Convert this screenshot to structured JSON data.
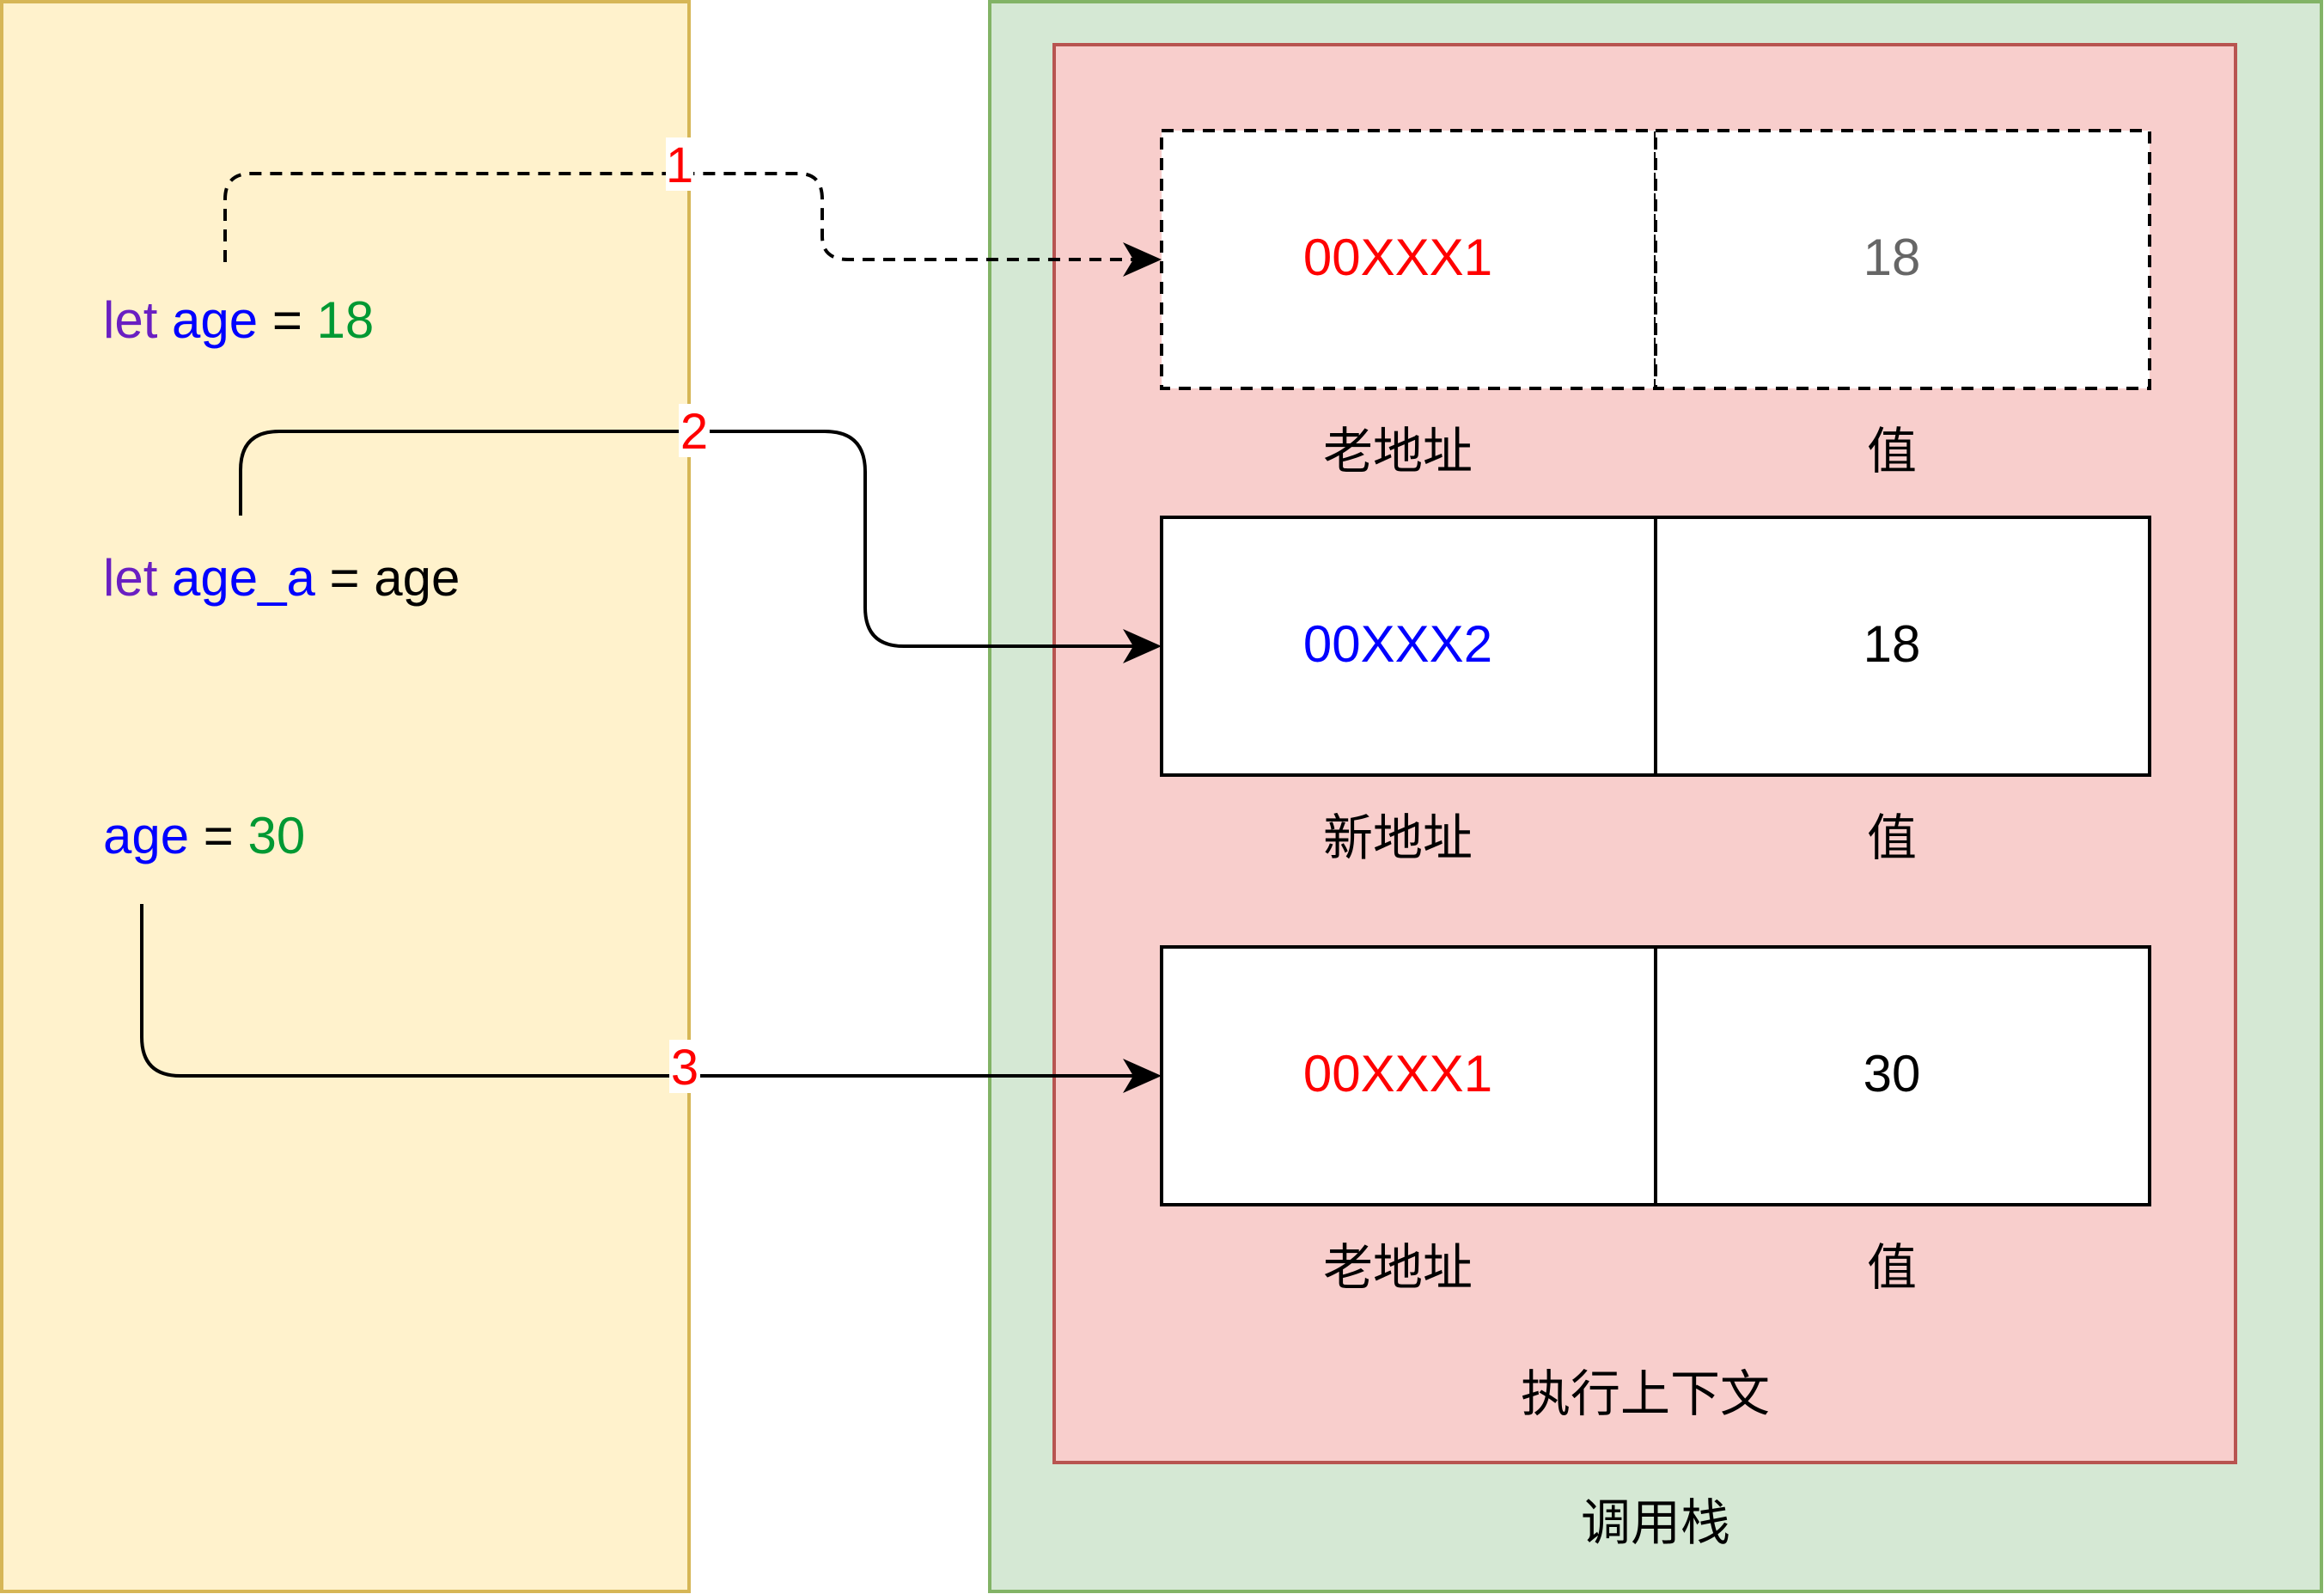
{
  "code_panel": {
    "lines": [
      {
        "tokens": [
          {
            "text": "let",
            "color": "#6a1fc2"
          },
          {
            "text": " age",
            "color": "#0000ff"
          },
          {
            "text": " = ",
            "color": "#000000"
          },
          {
            "text": "18",
            "color": "#009933"
          }
        ]
      },
      {
        "tokens": [
          {
            "text": "let",
            "color": "#6a1fc2"
          },
          {
            "text": " age_a",
            "color": "#0000ff"
          },
          {
            "text": " = ",
            "color": "#000000"
          },
          {
            "text": "age",
            "color": "#000000"
          }
        ]
      },
      {
        "tokens": [
          {
            "text": "age",
            "color": "#0000ff"
          },
          {
            "text": " = ",
            "color": "#000000"
          },
          {
            "text": "30",
            "color": "#009933"
          }
        ]
      }
    ]
  },
  "call_stack": {
    "label": "调用栈",
    "execution_context": {
      "label": "执行上下文",
      "entries": [
        {
          "address": "00XXX1",
          "address_color": "#ff0000",
          "value": "18",
          "value_color": "#666666",
          "address_label": "老地址",
          "value_label": "值",
          "dashed": true
        },
        {
          "address": "00XXX2",
          "address_color": "#0000ff",
          "value": "18",
          "value_color": "#000000",
          "address_label": "新地址",
          "value_label": "值",
          "dashed": false
        },
        {
          "address": "00XXX1",
          "address_color": "#ff0000",
          "value": "30",
          "value_color": "#000000",
          "address_label": "老地址",
          "value_label": "值",
          "dashed": false
        }
      ]
    }
  },
  "arrows": [
    {
      "label": "1",
      "style": "dashed"
    },
    {
      "label": "2",
      "style": "solid"
    },
    {
      "label": "3",
      "style": "solid"
    }
  ],
  "colors": {
    "code_panel_fill": "#fff2cc",
    "code_panel_stroke": "#d6b656",
    "stack_fill": "#d5e8d4",
    "stack_stroke": "#82b366",
    "context_fill": "#f8cecc",
    "context_stroke": "#b85450",
    "step_label": "#ff0000"
  }
}
